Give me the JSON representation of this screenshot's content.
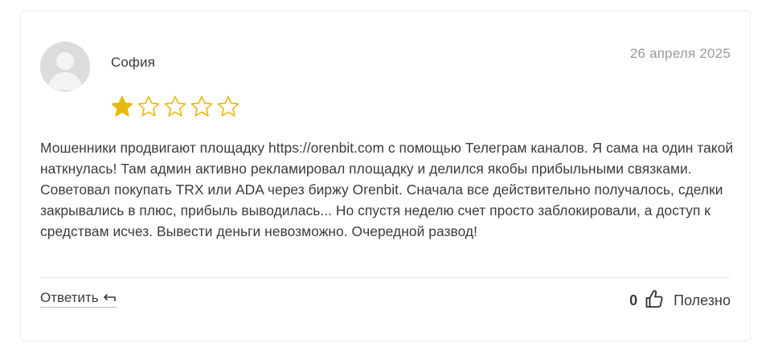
{
  "review": {
    "author": "София",
    "date": "26 апреля 2025",
    "rating": 1,
    "rating_max": 5,
    "star_color": "#e8b711",
    "text": "Мошенники продвигают площадку https://orenbit.com с помощью Телеграм каналов. Я сама на один такой наткнулась! Там админ активно рекламировал площадку и делился якобы прибыльными связками. Советовал покупать TRX или ADA через биржу Orenbit. Сначала все действительно получалось, сделки закрывались в плюс, прибыль выводилась... Но спустя неделю счет просто заблокировали, а доступ к средствам исчез. Вывести деньги невозможно. Очередной развод!",
    "avatar_icon": "user-avatar-placeholder"
  },
  "actions": {
    "reply_label": "Ответить",
    "reply_icon": "reply-arrow-icon",
    "helpful_count": "0",
    "helpful_icon": "thumbs-up-icon",
    "helpful_label": "Полезно"
  }
}
